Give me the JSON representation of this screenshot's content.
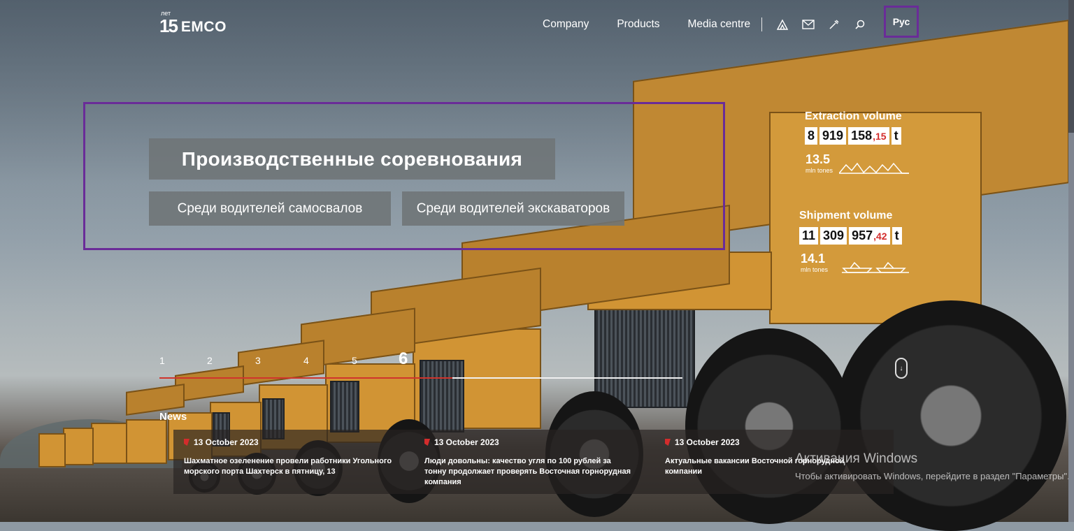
{
  "header": {
    "logo_years": "лет",
    "logo_mark": "15",
    "logo_name": "EMCO",
    "nav": [
      "Company",
      "Products",
      "Media centre"
    ],
    "icons": [
      "mine-icon",
      "mail-icon",
      "tools-icon",
      "search-icon"
    ],
    "lang": "Рус"
  },
  "hero": {
    "title": "Производственные соревнования",
    "btn_drivers_dump": "Среди водителей самосвалов",
    "btn_drivers_excavator": "Среди водителей экскаваторов"
  },
  "stats": {
    "extraction": {
      "title": "Extraction volume",
      "groups": [
        "8",
        "919",
        "158"
      ],
      "decimal": ",15",
      "unit": "t",
      "sub_value": "13.5",
      "sub_unit": "mln tones"
    },
    "shipment": {
      "title": "Shipment volume",
      "groups": [
        "11",
        "309",
        "957"
      ],
      "decimal": ",42",
      "unit": "t",
      "sub_value": "14.1",
      "sub_unit": "mln tones"
    }
  },
  "slider": {
    "numbers": [
      "1",
      "2",
      "3",
      "4",
      "5",
      "6"
    ],
    "active": "6",
    "progress": 0.56
  },
  "news": {
    "label": "News",
    "items": [
      {
        "date": "13 October 2023",
        "text": "Шахматное озеленение провели работники Угольного морского порта Шахтерск в пятницу, 13"
      },
      {
        "date": "13 October 2023",
        "text": "Люди довольны: качество угля по 100 рублей за тонну продолжает проверять Восточная горнорудная компания"
      },
      {
        "date": "13 October 2023",
        "text": "Актуальные вакансии Восточной горнорудной компании"
      }
    ]
  },
  "activation": {
    "title": "Активация Windows",
    "text": "Чтобы активировать Windows, перейдите в раздел \"Параметры\"."
  }
}
